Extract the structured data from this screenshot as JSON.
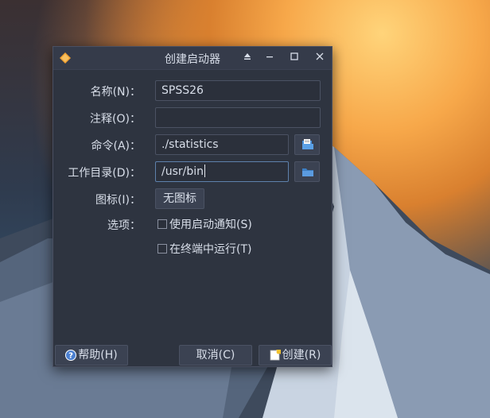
{
  "dialog": {
    "title": "创建启动器",
    "labels": {
      "name": "名称(N)：",
      "comment": "注释(O)：",
      "command": "命令(A)：",
      "workdir": "工作目录(D)：",
      "icon": "图标(I)：",
      "options": "选项："
    },
    "fields": {
      "name": "SPSS26",
      "comment": "",
      "command": "./statistics",
      "workdir": "/usr/bin"
    },
    "icon_button": "无图标",
    "checkboxes": {
      "startup_notify": {
        "label": "使用启动通知(S)",
        "checked": false
      },
      "run_in_terminal": {
        "label": "在终端中运行(T)",
        "checked": false
      }
    },
    "buttons": {
      "help": "帮助(H)",
      "cancel": "取消(C)",
      "create": "创建(R)"
    },
    "window_controls": [
      "shade",
      "minimize",
      "maximize",
      "close"
    ],
    "colors": {
      "accent": "#5e81ac",
      "background": "#2e3440",
      "text": "#d8dee9"
    }
  }
}
